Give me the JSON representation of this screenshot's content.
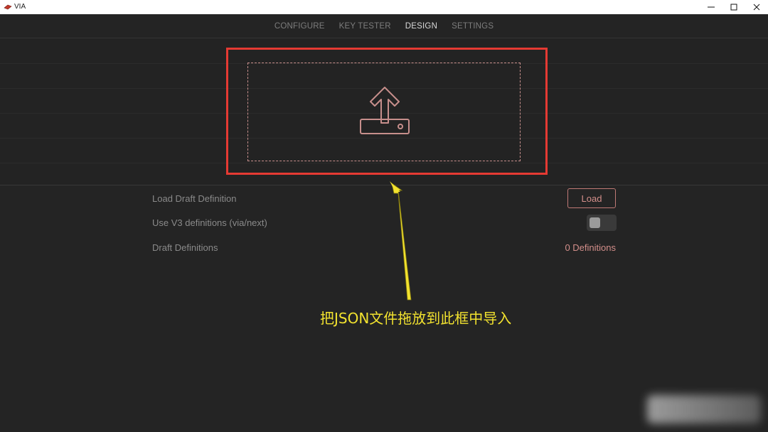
{
  "window": {
    "title": "VIA"
  },
  "nav": {
    "tabs": [
      {
        "label": "CONFIGURE"
      },
      {
        "label": "KEY TESTER"
      },
      {
        "label": "DESIGN"
      },
      {
        "label": "SETTINGS"
      }
    ],
    "active": "DESIGN"
  },
  "design": {
    "load_draft_label": "Load Draft Definition",
    "load_button_label": "Load",
    "use_v3_label": "Use V3 definitions (via/next)",
    "use_v3_enabled": false,
    "draft_definitions_label": "Draft Definitions",
    "draft_definitions_count": "0 Definitions"
  },
  "annotation": {
    "text": "把JSON文件拖放到此框中导入",
    "color": "#f2e22f"
  },
  "colors": {
    "accent": "#d48f8b",
    "highlight": "#e53a33",
    "background": "#242424"
  },
  "icons": [
    "via-logo-icon",
    "minimize-icon",
    "maximize-icon",
    "close-icon",
    "upload-icon"
  ]
}
